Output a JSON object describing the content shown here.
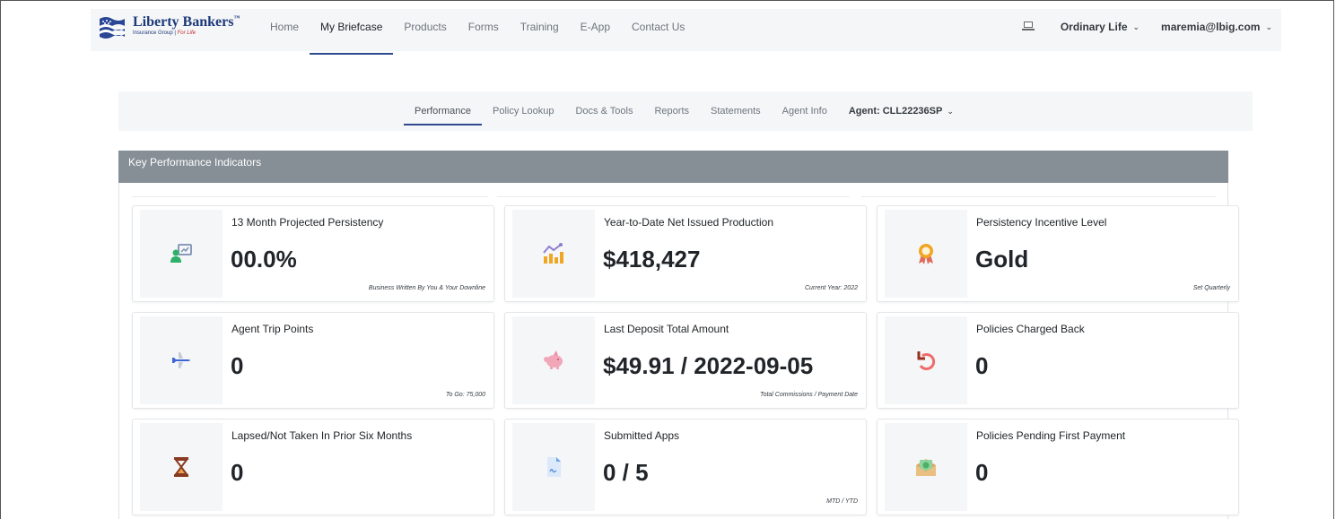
{
  "brand": {
    "name": "Liberty Bankers",
    "tm": "™",
    "sub": "Insurance Group",
    "tagline": "For Life"
  },
  "topnav": {
    "items": [
      {
        "label": "Home"
      },
      {
        "label": "My Briefcase"
      },
      {
        "label": "Products"
      },
      {
        "label": "Forms"
      },
      {
        "label": "Training"
      },
      {
        "label": "E-App"
      },
      {
        "label": "Contact Us"
      }
    ],
    "active": "My Briefcase",
    "line_dropdown": "Ordinary Life",
    "user_dropdown": "maremia@lbig.com"
  },
  "subnav": {
    "items": [
      {
        "label": "Performance"
      },
      {
        "label": "Policy Lookup"
      },
      {
        "label": "Docs & Tools"
      },
      {
        "label": "Reports"
      },
      {
        "label": "Statements"
      },
      {
        "label": "Agent Info"
      }
    ],
    "active": "Performance",
    "agent_dropdown": "Agent: CLL22236SP"
  },
  "kpi": {
    "title": "Key Performance Indicators",
    "cards": [
      {
        "label": "13 Month Projected Persistency",
        "value": "00.0%",
        "note": "Business Written By You & Your Downline",
        "icon": "presentation-icon"
      },
      {
        "label": "Year-to-Date Net Issued Production",
        "value": "$418,427",
        "note": "Current Year: 2022",
        "icon": "chart-icon"
      },
      {
        "label": "Persistency Incentive Level",
        "value": "Gold",
        "note": "Set Quarterly",
        "icon": "award-icon"
      },
      {
        "label": "Agent Trip Points",
        "value": "0",
        "note": "To Go: 75,000",
        "icon": "airplane-icon"
      },
      {
        "label": "Last Deposit Total Amount",
        "value": "$49.91 / 2022-09-05",
        "note": "Total Commissions / Payment Date",
        "icon": "piggy-bank-icon"
      },
      {
        "label": "Policies Charged Back",
        "value": "0",
        "note": "",
        "icon": "undo-icon"
      },
      {
        "label": "Lapsed/Not Taken In Prior Six Months",
        "value": "0",
        "note": "",
        "icon": "hourglass-icon"
      },
      {
        "label": "Submitted Apps",
        "value": "0 / 5",
        "note": "MTD / YTD",
        "icon": "document-icon"
      },
      {
        "label": "Policies Pending First Payment",
        "value": "0",
        "note": "",
        "icon": "money-envelope-icon"
      }
    ]
  },
  "colors": {
    "nav_bg": "#f5f6f8",
    "accent": "#2f4a8f",
    "kpi_header": "#868e96"
  }
}
